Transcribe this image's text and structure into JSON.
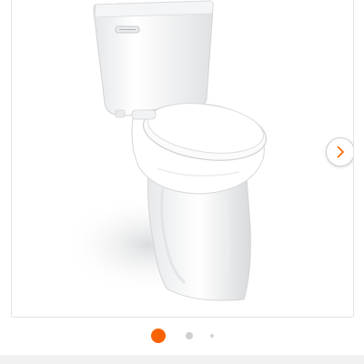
{
  "product_gallery": {
    "image_alt": "",
    "next_button_icon": "chevron-right-icon",
    "total_slides": 3,
    "active_slide": 1
  },
  "colors": {
    "accent": "#f96302",
    "inactive_dot": "#cfcfcf",
    "arrow": "#f96302"
  }
}
